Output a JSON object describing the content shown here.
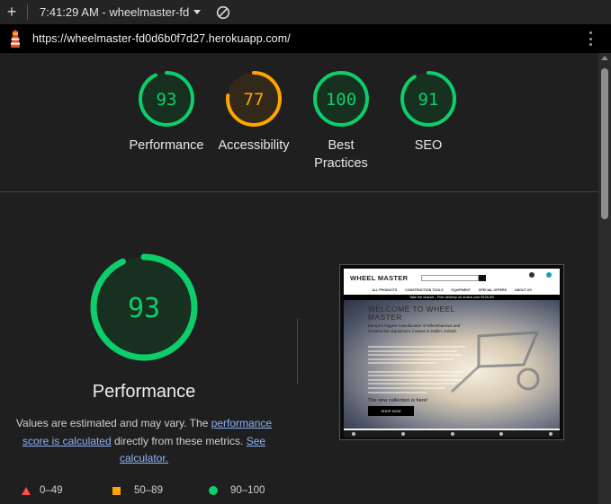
{
  "toolbar": {
    "new_tab_label": "+",
    "title": "7:41:29 AM - wheelmaster-fd"
  },
  "urlbar": {
    "url": "https://wheelmaster-fd0d6b0f7d27.herokuapp.com/"
  },
  "colors": {
    "pass": "#0cce6b",
    "average": "#ffa400",
    "fail": "#ff4e42",
    "link": "#8ab4f8"
  },
  "gauges": [
    {
      "label": "Performance",
      "score": "93"
    },
    {
      "label": "Accessibility",
      "score": "77"
    },
    {
      "label": "Best Practices",
      "score": "100"
    },
    {
      "label": "SEO",
      "score": "91"
    }
  ],
  "performance": {
    "score": "93",
    "title": "Performance",
    "desc_prefix": "Values are estimated and may vary. The ",
    "link1": "performance score is calculated",
    "desc_middle": " directly from these metrics. ",
    "link2": "See calculator."
  },
  "thumbnail": {
    "logo": "WHEEL MASTER",
    "nav": [
      "ALL PRODUCTS",
      "CONSTRUCTION TOOLS",
      "EQUIPMENT",
      "SPECIAL OFFERS",
      "ABOUT US"
    ],
    "banner": "Take the chance - Free delivery on orders over €100.00!",
    "heading": "WELCOME TO WHEEL MASTER",
    "subheading": "Europe's biggest manufacturer of Wheelbarrows and Construction Equipment, located in Dublin, Ireland.",
    "new_collection": "The new collection is here!",
    "shop_button": "SHOP NOW"
  },
  "legend": [
    {
      "range": "0–49",
      "icon": "fail-triangle-icon"
    },
    {
      "range": "50–89",
      "icon": "average-square-icon"
    },
    {
      "range": "90–100",
      "icon": "pass-circle-icon"
    }
  ]
}
